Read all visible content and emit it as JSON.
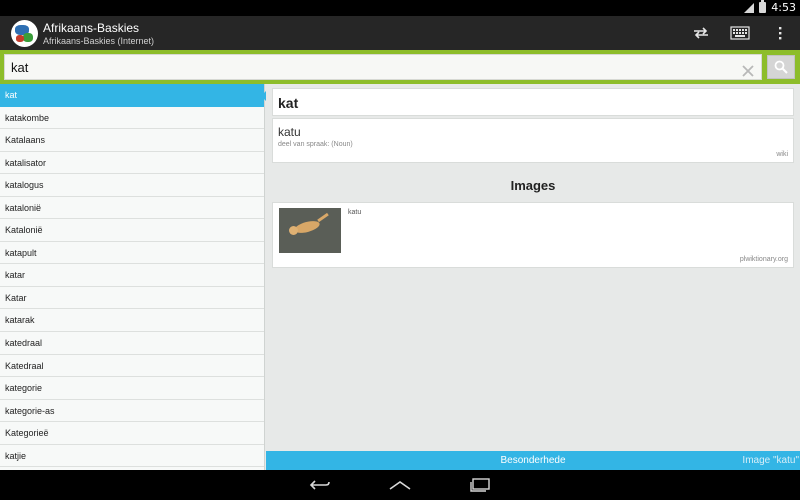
{
  "status_bar": {
    "time": "4:53"
  },
  "action_bar": {
    "title": "Afrikaans-Baskies",
    "subtitle": "Afrikaans-Baskies (Internet)"
  },
  "search": {
    "value": "kat",
    "placeholder": ""
  },
  "word_list": {
    "items": [
      "kat",
      "katakombe",
      "Katalaans",
      "katalisator",
      "katalogus",
      "katalonië",
      "Katalonië",
      "katapult",
      "katar",
      "Katar",
      "katarak",
      "katedraal",
      "Katedraal",
      "kategorie",
      "kategorie-as",
      "Kategorieë",
      "katjie"
    ],
    "selected_index": 0
  },
  "detail": {
    "headword": "kat",
    "translation": {
      "word": "katu",
      "part_of_speech": "deel van spraak: (Noun)",
      "source": "wiki"
    },
    "images_heading": "Images",
    "image": {
      "caption": "katu",
      "source": "plwiktionary.org"
    }
  },
  "bottom_tabs": {
    "details": "Besonderhede",
    "image": "Image \"katu\""
  },
  "colors": {
    "accent": "#33b5e5",
    "search_border": "#8dbd2a",
    "action_bar": "#262626"
  }
}
